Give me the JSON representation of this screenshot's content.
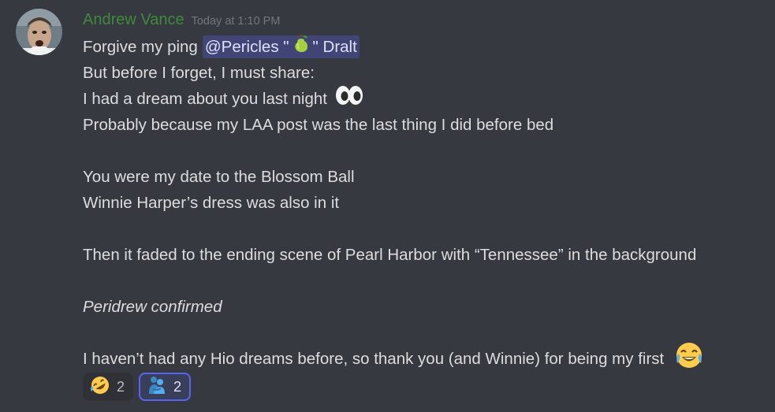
{
  "message": {
    "author": "Andrew Vance",
    "timestamp": "Today at 1:10 PM",
    "lines": {
      "l1_text": "Forgive my ping",
      "mention_prefix": "@Pericles \"",
      "mention_suffix": "\" Dralt",
      "l2": "But before I forget, I must share:",
      "l3": "I had a dream about you last night",
      "l4": "Probably because my LAA post was the last thing I did before bed",
      "l6": "You were my date to the Blossom Ball",
      "l7": "Winnie Harper’s dress was also in it",
      "l9": "Then it faded to the ending scene of Pearl Harbor with “Tennessee” in the background",
      "l11": "Peridrew confirmed",
      "l13": "I haven’t had any Hio dreams before, so thank you (and Winnie) for being my first"
    },
    "mention_emoji": "pear-icon",
    "line3_emoji": "eyes-icon",
    "line13_emoji": "joy-icon"
  },
  "reactions": [
    {
      "emoji": "rofl-icon",
      "count": "2",
      "active": false
    },
    {
      "emoji": "people-hugging-icon",
      "count": "2",
      "active": true
    }
  ],
  "colors": {
    "background": "#36393f",
    "username": "#3e8a3a",
    "mention_bg": "rgba(88,101,242,0.3)",
    "accent": "#5865f2"
  }
}
